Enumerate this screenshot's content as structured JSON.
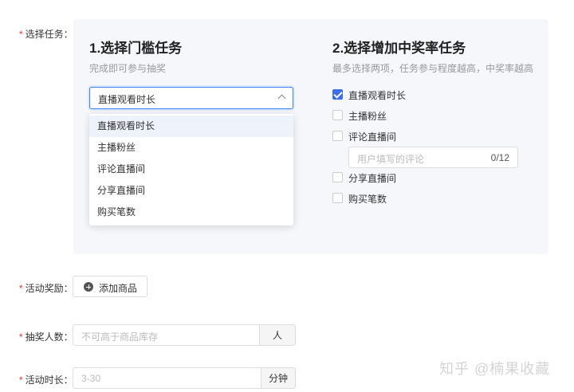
{
  "form": {
    "task_label": "选择任务：",
    "reward_label": "活动奖励：",
    "winners_label": "抽奖人数：",
    "duration_label": "活动时长："
  },
  "threshold": {
    "title": "1.选择门槛任务",
    "subtitle": "完成即可参与抽奖",
    "selected": "直播观看时长",
    "options": [
      "直播观看时长",
      "主播粉丝",
      "评论直播间",
      "分享直播间",
      "购买笔数"
    ],
    "selected_index": 0
  },
  "bonus": {
    "title": "2.选择增加中奖率任务",
    "subtitle": "最多选择两项，任务参与程度越高，中奖率越高",
    "options": [
      {
        "label": "直播观看时长",
        "checked": true
      },
      {
        "label": "主播粉丝",
        "checked": false
      },
      {
        "label": "评论直播间",
        "checked": false
      },
      {
        "label": "分享直播间",
        "checked": false
      },
      {
        "label": "购买笔数",
        "checked": false
      }
    ],
    "comment_placeholder": "用户填写的评论",
    "comment_count": "0/12"
  },
  "reward": {
    "add_button": "添加商品"
  },
  "winners": {
    "placeholder": "不可高于商品库存",
    "unit": "人"
  },
  "duration": {
    "placeholder": "3-30",
    "unit": "分钟"
  },
  "watermark": "知乎 @楠果收藏",
  "colors": {
    "accent": "#3b6ee8",
    "required": "#ee3333",
    "panel_bg": "#f5f7fb"
  }
}
